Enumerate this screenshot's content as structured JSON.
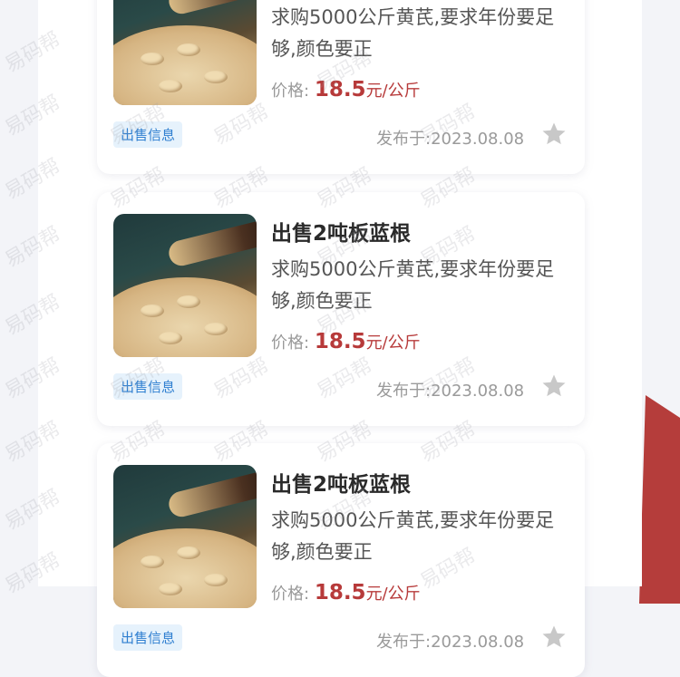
{
  "watermark_text": "易码帮",
  "listings": [
    {
      "title": "",
      "desc": "求购5000公斤黄芪,要求年份要足够,颜色要正",
      "price_label": "价格:",
      "price_value": "18.5",
      "price_unit": "元/公斤",
      "tag": "出售信息",
      "date": "发布于:2023.08.08"
    },
    {
      "title": "出售2吨板蓝根",
      "desc": "求购5000公斤黄芪,要求年份要足够,颜色要正",
      "price_label": "价格:",
      "price_value": "18.5",
      "price_unit": "元/公斤",
      "tag": "出售信息",
      "date": "发布于:2023.08.08"
    },
    {
      "title": "出售2吨板蓝根",
      "desc": "求购5000公斤黄芪,要求年份要足够,颜色要正",
      "price_label": "价格:",
      "price_value": "18.5",
      "price_unit": "元/公斤",
      "tag": "出售信息",
      "date": "发布于:2023.08.08"
    }
  ]
}
